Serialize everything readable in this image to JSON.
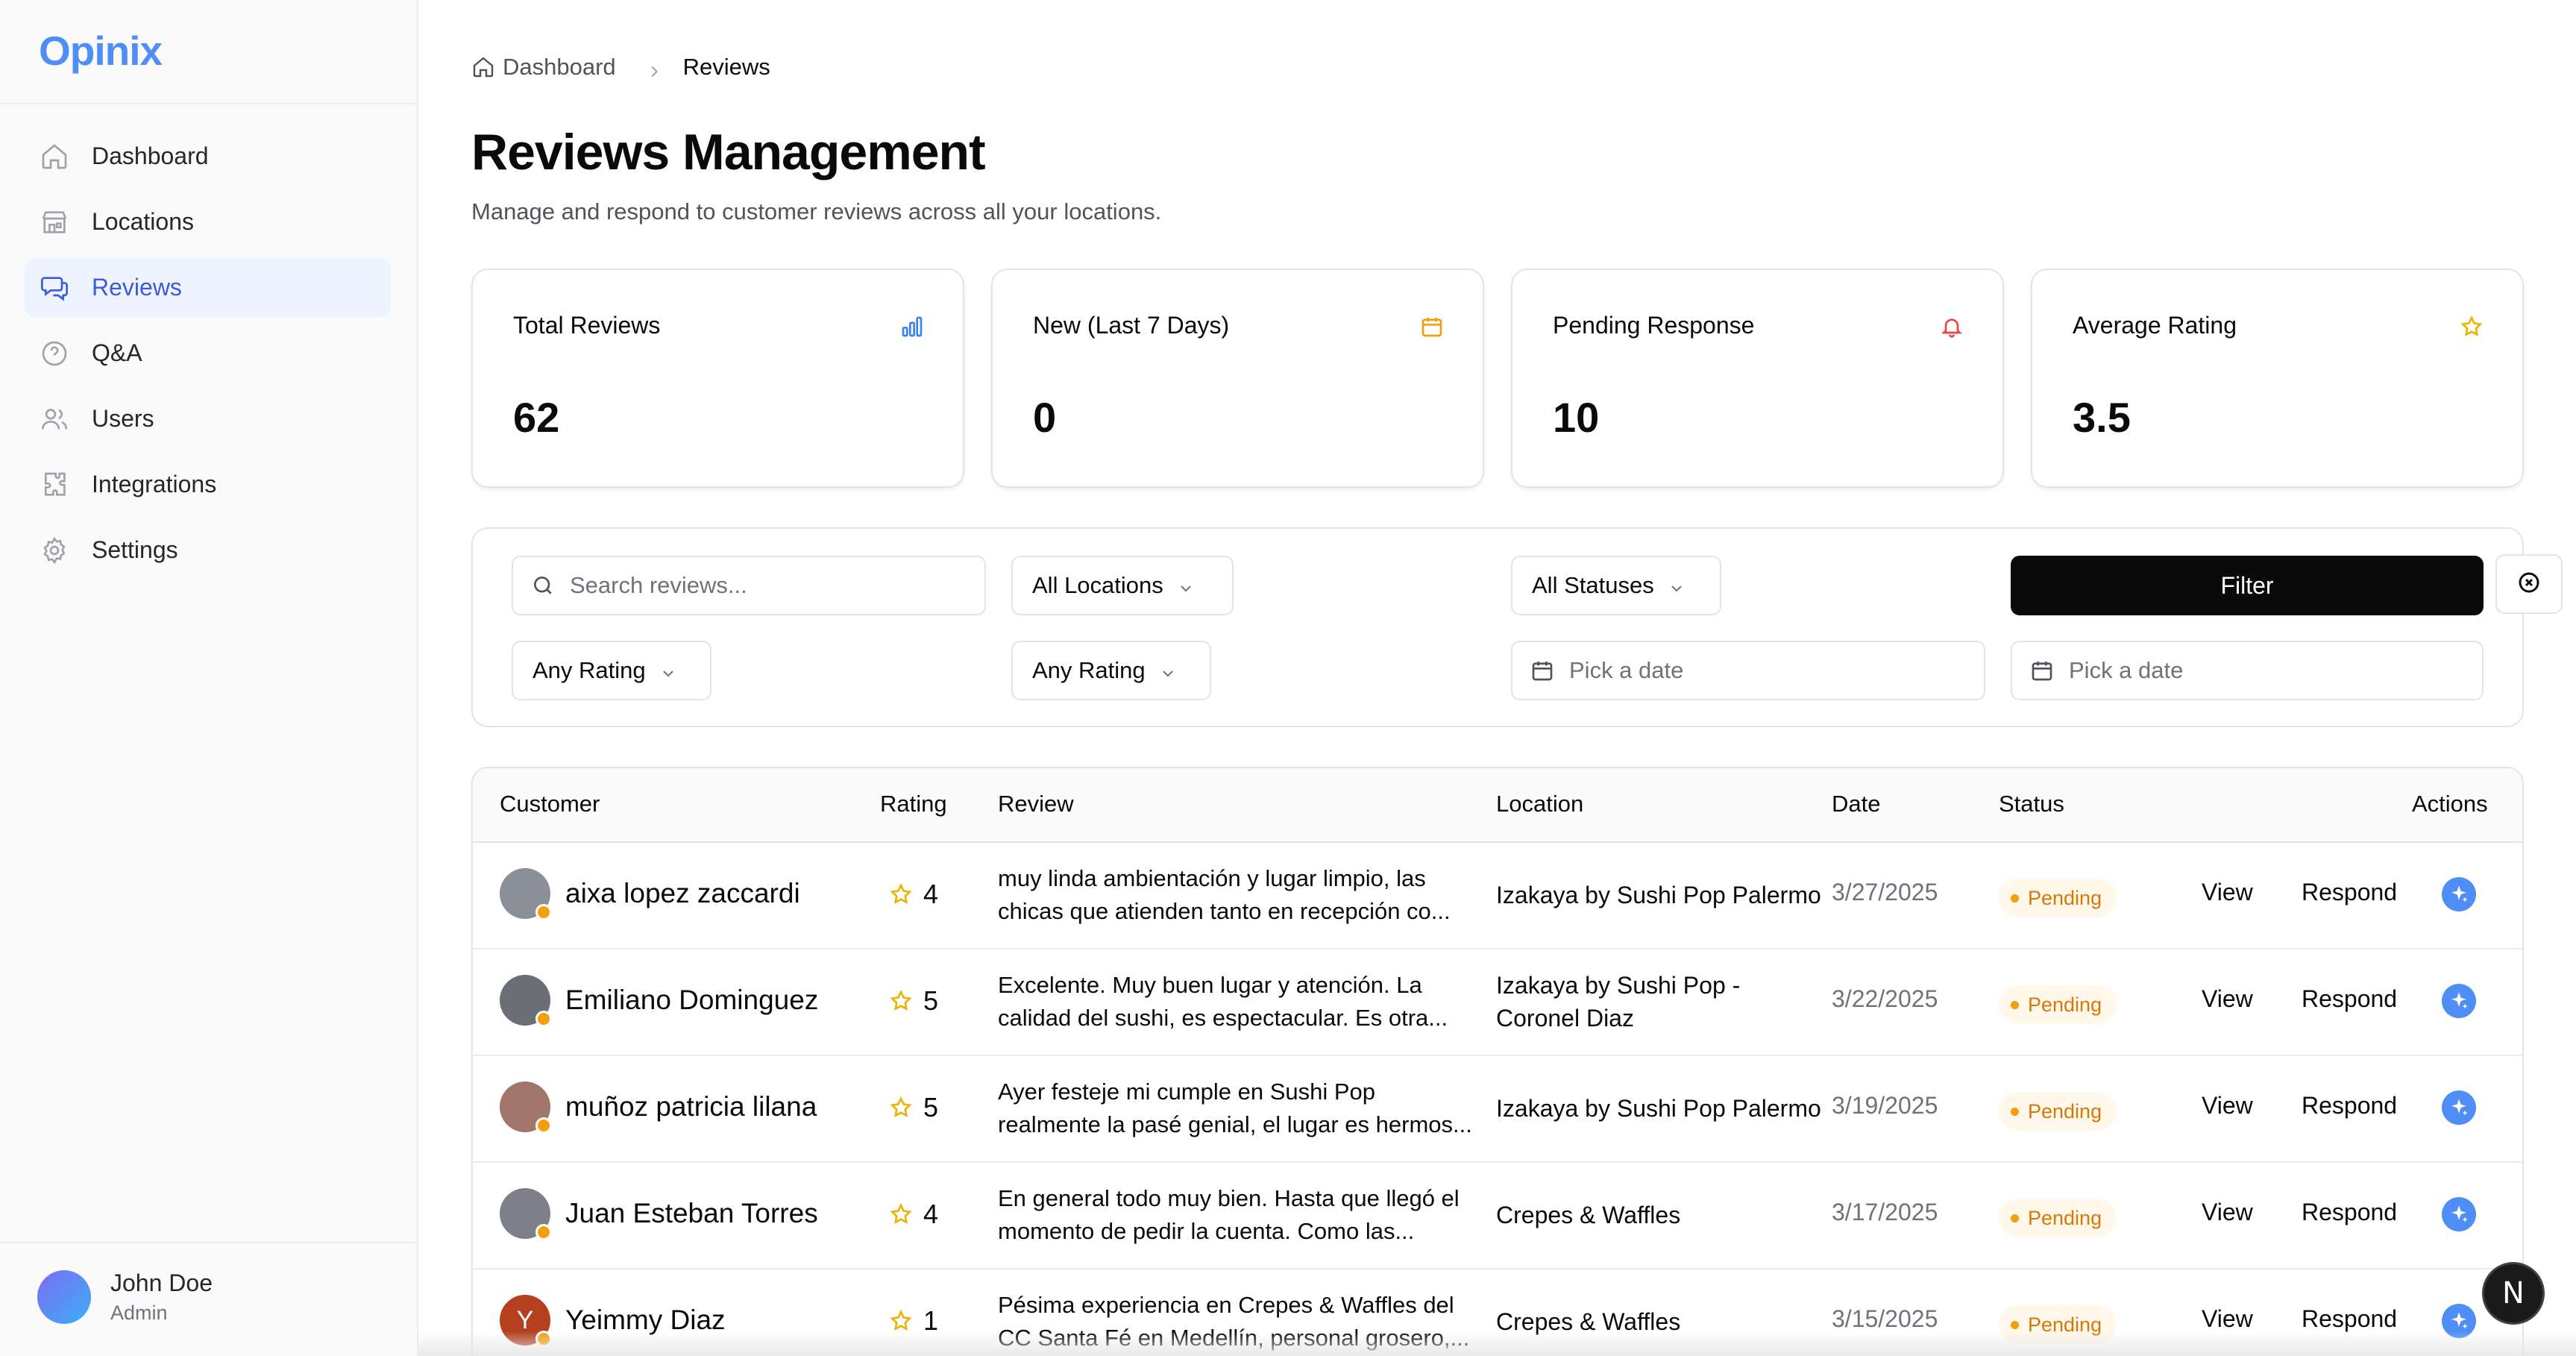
{
  "app": {
    "logo": "Opinix"
  },
  "sidebar": {
    "items": [
      {
        "label": "Dashboard",
        "icon": "home-icon",
        "active": false
      },
      {
        "label": "Locations",
        "icon": "store-icon",
        "active": false
      },
      {
        "label": "Reviews",
        "icon": "messages-icon",
        "active": true
      },
      {
        "label": "Q&A",
        "icon": "help-circle-icon",
        "active": false
      },
      {
        "label": "Users",
        "icon": "users-icon",
        "active": false
      },
      {
        "label": "Integrations",
        "icon": "puzzle-icon",
        "active": false
      },
      {
        "label": "Settings",
        "icon": "gear-icon",
        "active": false
      }
    ],
    "user": {
      "name": "John Doe",
      "role": "Admin"
    }
  },
  "breadcrumb": {
    "home": "Dashboard",
    "current": "Reviews"
  },
  "page": {
    "title": "Reviews Management",
    "subtitle": "Manage and respond to customer reviews across all your locations."
  },
  "stats": [
    {
      "title": "Total Reviews",
      "value": "62",
      "icon": "bar-chart-icon",
      "color": "#3b82f6"
    },
    {
      "title": "New (Last 7 Days)",
      "value": "0",
      "icon": "calendar-icon",
      "color": "#f59e0b"
    },
    {
      "title": "Pending Response",
      "value": "10",
      "icon": "bell-icon",
      "color": "#ef4444"
    },
    {
      "title": "Average Rating",
      "value": "3.5",
      "icon": "star-icon",
      "color": "#eab308"
    }
  ],
  "filters": {
    "search_placeholder": "Search reviews...",
    "location_select": "All Locations",
    "status_select": "All Statuses",
    "filter_button": "Filter",
    "rating_min": "Any Rating",
    "rating_max": "Any Rating",
    "date_from_placeholder": "Pick a date",
    "date_to_placeholder": "Pick a date"
  },
  "table": {
    "columns": [
      "Customer",
      "Rating",
      "Review",
      "Location",
      "Date",
      "Status",
      "Actions"
    ],
    "rows": [
      {
        "customer": "aixa lopez zaccardi",
        "rating": "4",
        "review_l1": "muy linda ambientación y lugar limpio, las",
        "review_l2": "chicas que atienden tanto en recepción co...",
        "location_l1": "Izakaya by Sushi Pop Palermo",
        "location_l2": "",
        "date": "3/27/2025",
        "status": "Pending",
        "view": "View",
        "respond": "Respond",
        "avatar_color": "#8a8f98",
        "initial": ""
      },
      {
        "customer": "Emiliano Dominguez",
        "rating": "5",
        "review_l1": "Excelente. Muy buen lugar y atención. La",
        "review_l2": "calidad del sushi, es espectacular. Es otra...",
        "location_l1": "Izakaya by Sushi Pop -",
        "location_l2": "Coronel Diaz",
        "date": "3/22/2025",
        "status": "Pending",
        "view": "View",
        "respond": "Respond",
        "avatar_color": "#6b6f75",
        "initial": ""
      },
      {
        "customer": "muñoz patricia lilana",
        "rating": "5",
        "review_l1": "Ayer festeje mi cumple en Sushi Pop",
        "review_l2": "realmente la pasé genial, el lugar es hermos...",
        "location_l1": "Izakaya by Sushi Pop Palermo",
        "location_l2": "",
        "date": "3/19/2025",
        "status": "Pending",
        "view": "View",
        "respond": "Respond",
        "avatar_color": "#a0776a",
        "initial": ""
      },
      {
        "customer": "Juan Esteban Torres",
        "rating": "4",
        "review_l1": "En general todo muy bien. Hasta que llegó el",
        "review_l2": "momento de pedir la cuenta. Como las...",
        "location_l1": "Crepes & Waffles",
        "location_l2": "",
        "date": "3/17/2025",
        "status": "Pending",
        "view": "View",
        "respond": "Respond",
        "avatar_color": "#7d8088",
        "initial": ""
      },
      {
        "customer": "Yeimmy Diaz",
        "rating": "1",
        "review_l1": "Pésima experiencia en Crepes & Waffles del",
        "review_l2": "CC Santa Fé en Medellín, personal grosero,...",
        "location_l1": "Crepes & Waffles",
        "location_l2": "",
        "date": "3/15/2025",
        "status": "Pending",
        "view": "View",
        "respond": "Respond",
        "avatar_color": "#b5401f",
        "initial": "Y"
      }
    ]
  },
  "fab": {
    "label": "N"
  }
}
